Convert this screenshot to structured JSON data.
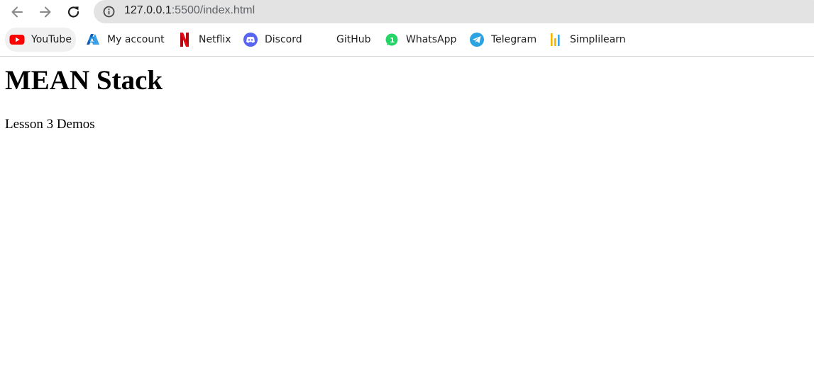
{
  "browser": {
    "address_bar": {
      "host": "127.0.0.1",
      "path": ":5500/index.html"
    },
    "bookmarks": [
      {
        "label": "YouTube",
        "icon": "youtube-icon",
        "color": "#ff0000"
      },
      {
        "label": "My account",
        "icon": "azure-icon",
        "color": "#0078d4"
      },
      {
        "label": "Netflix",
        "icon": "netflix-icon",
        "color": "#e50914"
      },
      {
        "label": "Discord",
        "icon": "discord-icon",
        "color": "#5865f2"
      },
      {
        "label": "GitHub",
        "icon": "github-icon",
        "color": "#ffffff"
      },
      {
        "label": "WhatsApp",
        "icon": "whatsapp-icon",
        "color": "#25d366"
      },
      {
        "label": "Telegram",
        "icon": "telegram-icon",
        "color": "#2aa3e0"
      },
      {
        "label": "Simplilearn",
        "icon": "simplilearn-icon",
        "color": "#f4b400"
      }
    ]
  },
  "page": {
    "heading": "MEAN Stack",
    "subtitle": "Lesson 3 Demos"
  }
}
